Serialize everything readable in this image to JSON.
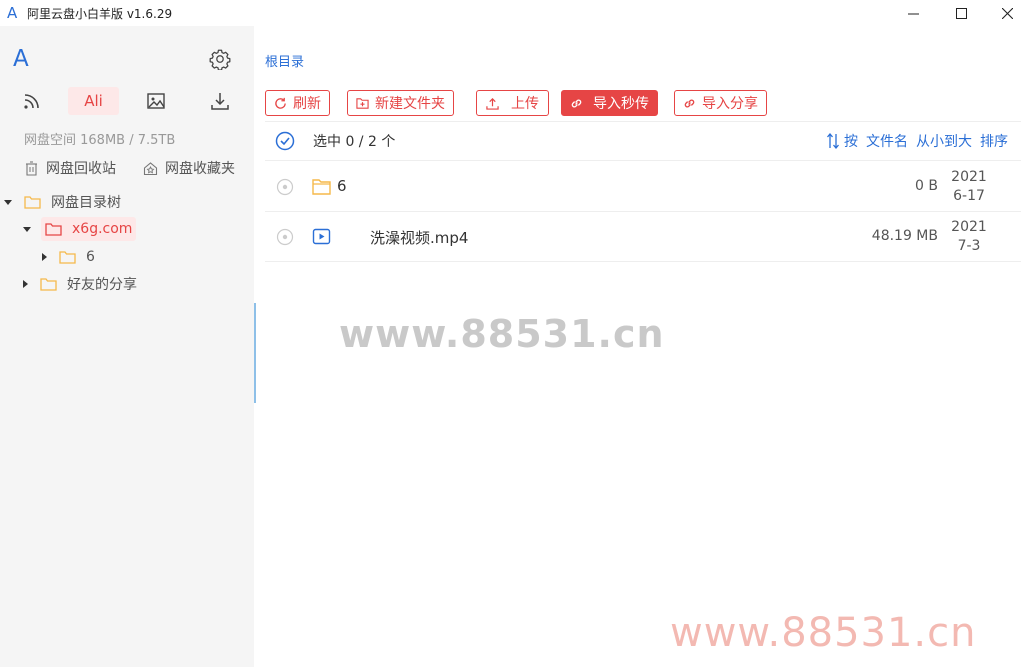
{
  "window": {
    "title": "阿里云盘小白羊版 v1.6.29",
    "app_icon_glyph": "A"
  },
  "sidebar": {
    "logo": "A",
    "nav": [
      {
        "icon": "rss-icon"
      },
      {
        "label": "Ali",
        "active": true
      },
      {
        "icon": "image-icon"
      },
      {
        "icon": "download-icon"
      }
    ],
    "quota": "网盘空间 168MB / 7.5TB",
    "recycle_label": "网盘回收站",
    "favorites_label": "网盘收藏夹",
    "tree": {
      "root_label": "网盘目录树",
      "selected_label": "x6g.com",
      "child_label": "6",
      "share_label": "好友的分享"
    }
  },
  "breadcrumb": "根目录",
  "toolbar": {
    "refresh": "刷新",
    "new_folder": "新建文件夹",
    "upload": "上传",
    "import_instant": "导入秒传",
    "import_share": "导入分享"
  },
  "list": {
    "selection": "选中 0 / 2 个",
    "sort": {
      "prefix": "按",
      "field": "文件名",
      "order": "从小到大",
      "action": "排序"
    },
    "rows": [
      {
        "type": "folder",
        "name": "6",
        "size": "0 B",
        "date_year": "2021",
        "date_md": "6-17"
      },
      {
        "type": "video",
        "name": "洗澡视频.mp4",
        "size": "48.19 MB",
        "date_year": "2021",
        "date_md": "7-3"
      }
    ]
  },
  "watermarks": {
    "center": "www.88531.cn",
    "corner": "www.88531.cn"
  },
  "colors": {
    "accent": "#e64545",
    "link": "#2b6fd6",
    "folder": "#f5b94a"
  }
}
